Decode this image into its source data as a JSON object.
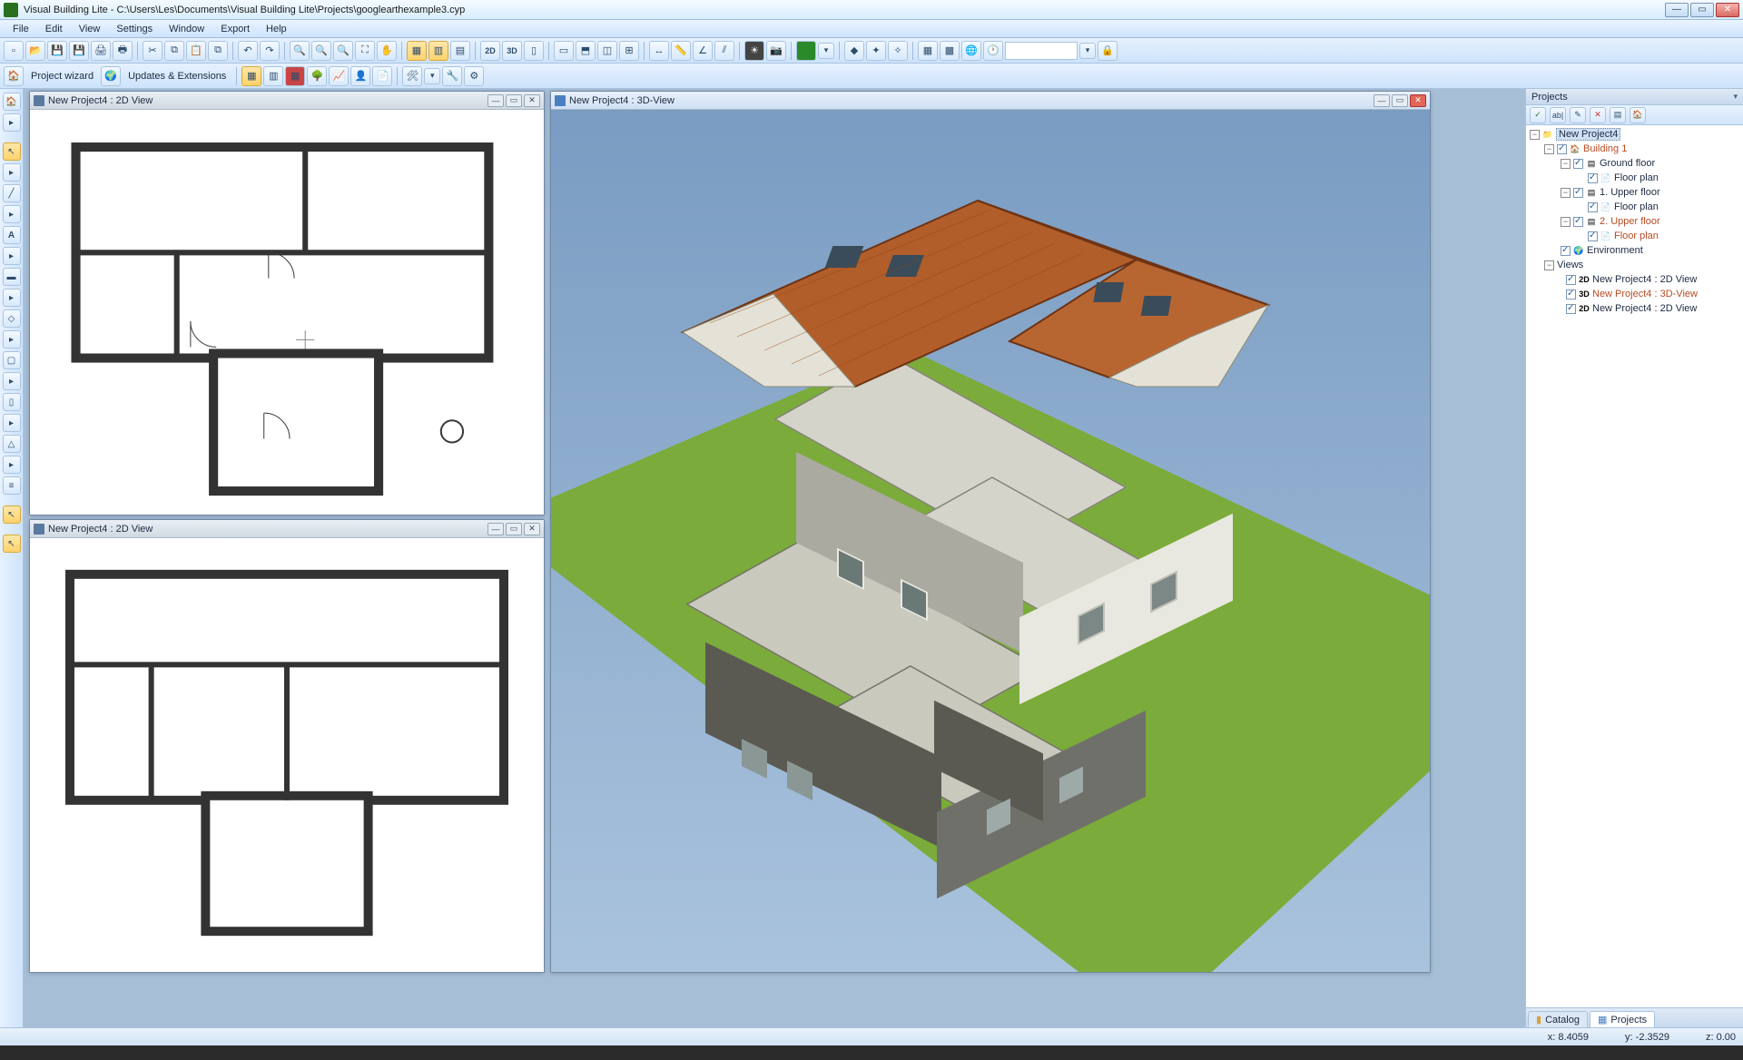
{
  "title": "Visual Building Lite - C:\\Users\\Les\\Documents\\Visual Building Lite\\Projects\\googlearthexample3.cyp",
  "menu": [
    "File",
    "Edit",
    "View",
    "Settings",
    "Window",
    "Export",
    "Help"
  ],
  "toolbar2": {
    "project_wizard": "Project wizard",
    "updates": "Updates & Extensions"
  },
  "windows": {
    "panel2d_a": "New Project4 : 2D View",
    "panel2d_b": "New Project4 : 2D View",
    "panel3d": "New Project4 : 3D-View"
  },
  "projects": {
    "header": "Projects",
    "root": "New Project4",
    "building": "Building 1",
    "ground": "Ground floor",
    "floorplan": "Floor plan",
    "upper1": "1. Upper floor",
    "upper2": "2. Upper floor",
    "env": "Environment",
    "views_label": "Views",
    "views": [
      {
        "tag": "2D",
        "label": "New Project4 : 2D View"
      },
      {
        "tag": "3D",
        "label": "New Project4 : 3D-View"
      },
      {
        "tag": "2D",
        "label": "New Project4 : 2D View"
      }
    ],
    "tabs": {
      "catalog": "Catalog",
      "projects": "Projects"
    }
  },
  "status": {
    "x": "x: 8.4059",
    "y": "y: -2.3529",
    "z": "z: 0.00"
  }
}
